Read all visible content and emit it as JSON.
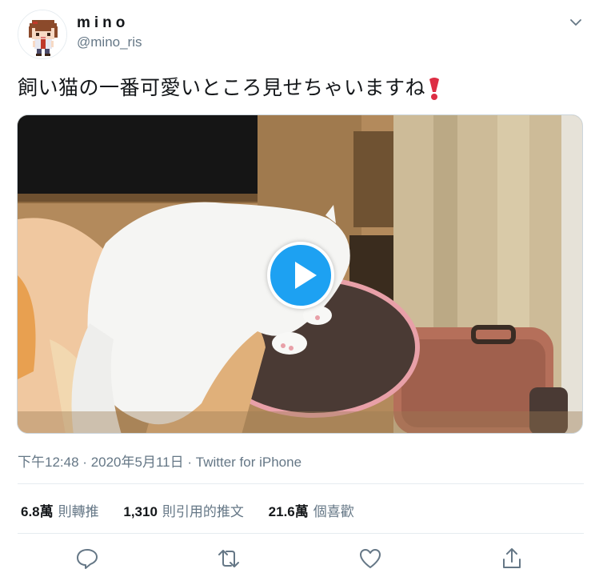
{
  "tweet": {
    "author": {
      "display_name": "mino",
      "handle": "@mino_ris",
      "avatar_icon": "pixel-art-avatar-icon"
    },
    "text": "飼い猫の一番可愛いところ見せちゃいますね",
    "text_emoji": "heavy-exclamation-mark-icon",
    "media": {
      "type": "video",
      "description_icon": "play-icon"
    },
    "meta": {
      "time": "下午12:48",
      "separator": "·",
      "date": "2020年5月11日",
      "source": "Twitter for iPhone"
    },
    "stats": [
      {
        "count": "6.8萬",
        "label": "則轉推"
      },
      {
        "count": "1,310",
        "label": "則引用的推文"
      },
      {
        "count": "21.6萬",
        "label": "個喜歡"
      }
    ],
    "actions": [
      "reply-icon",
      "retweet-icon",
      "like-icon",
      "share-icon"
    ]
  },
  "colors": {
    "accent": "#1da1f2",
    "secondary_text": "#657786",
    "primary_text": "#14171a",
    "divider": "#e6ecf0",
    "emoji_red": "#dd2e44"
  }
}
